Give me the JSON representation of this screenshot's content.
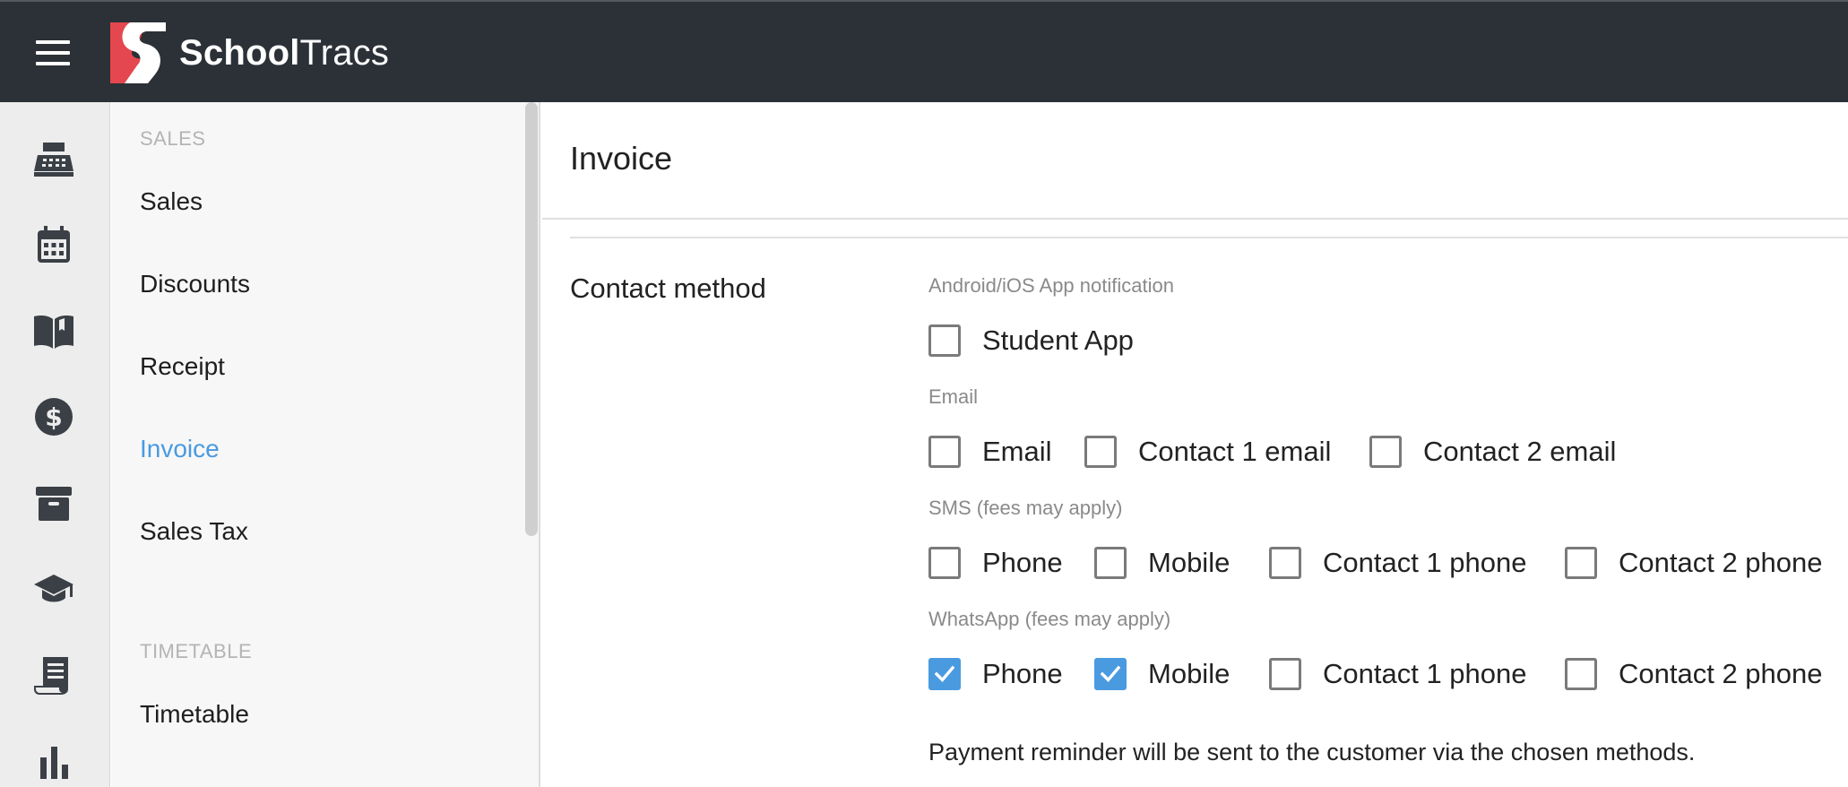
{
  "app": {
    "name_bold": "School",
    "name_light": "Tracs",
    "brand_color": "#e4474f",
    "topbar_color": "#2b3137",
    "accent_color": "#4a9ae0"
  },
  "rail": {
    "icons": [
      "cash-register-icon",
      "calendar-icon",
      "book-icon",
      "dollar-icon",
      "archive-icon",
      "graduation-cap-icon",
      "receipt-icon",
      "bar-chart-icon"
    ]
  },
  "subnav": {
    "sections": [
      {
        "title": "SALES",
        "items": [
          "Sales",
          "Discounts",
          "Receipt",
          "Invoice",
          "Sales Tax"
        ]
      },
      {
        "title": "TIMETABLE",
        "items": [
          "Timetable"
        ]
      }
    ],
    "active_item": "Invoice"
  },
  "main": {
    "title": "Invoice",
    "contact_method": {
      "label": "Contact method",
      "groups": [
        {
          "title": "Android/iOS App notification",
          "options": [
            {
              "label": "Student App",
              "checked": false
            }
          ]
        },
        {
          "title": "Email",
          "options": [
            {
              "label": "Email",
              "checked": false
            },
            {
              "label": "Contact 1 email",
              "checked": false
            },
            {
              "label": "Contact 2 email",
              "checked": false
            }
          ]
        },
        {
          "title": "SMS (fees may apply)",
          "options": [
            {
              "label": "Phone",
              "checked": false
            },
            {
              "label": "Mobile",
              "checked": false
            },
            {
              "label": "Contact 1 phone",
              "checked": false
            },
            {
              "label": "Contact 2 phone",
              "checked": false
            }
          ]
        },
        {
          "title": "WhatsApp (fees may apply)",
          "options": [
            {
              "label": "Phone",
              "checked": true
            },
            {
              "label": "Mobile",
              "checked": true
            },
            {
              "label": "Contact 1 phone",
              "checked": false
            },
            {
              "label": "Contact 2 phone",
              "checked": false
            }
          ]
        }
      ],
      "note": "Payment reminder will be sent to the customer via the chosen methods."
    }
  }
}
